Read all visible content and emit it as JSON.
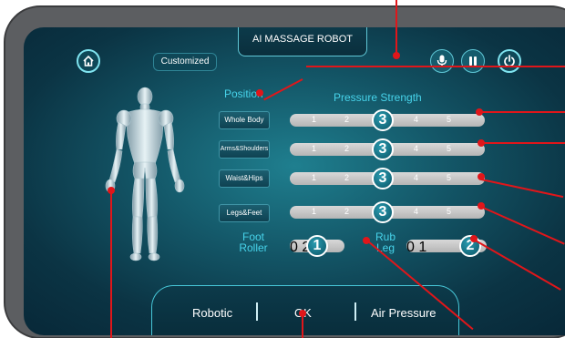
{
  "header": {
    "title": "AI MASSAGE ROBOT",
    "customized_label": "Customized"
  },
  "icons": {
    "home": "home-icon",
    "mic": "microphone-icon",
    "pause": "pause-icon",
    "power": "power-icon"
  },
  "position": {
    "heading": "Position",
    "items": [
      {
        "label": "Whole Body"
      },
      {
        "label": "Arms&Shoulders"
      },
      {
        "label": "Waist&Hips"
      },
      {
        "label": "Legs&Feet"
      }
    ]
  },
  "pressure": {
    "heading": "Pressure Strength",
    "levels": [
      "1",
      "2",
      "3",
      "4",
      "5"
    ],
    "sliders": [
      {
        "value": "3"
      },
      {
        "value": "3"
      },
      {
        "value": "3"
      },
      {
        "value": "3"
      }
    ]
  },
  "foot_roller": {
    "label_line1": "Foot",
    "label_line2": "Roller",
    "levels": [
      "0",
      "1",
      "2"
    ],
    "value": "1"
  },
  "rub_leg": {
    "label_line1": "Rub",
    "label_line2": "Leg",
    "levels": [
      "0",
      "1",
      "2"
    ],
    "value": "2"
  },
  "bottom_bar": {
    "robotic": "Robotic",
    "ok": "OK",
    "air_pressure": "Air Pressure"
  },
  "colors": {
    "accent": "#47d3ea",
    "callout": "#e0161a"
  }
}
